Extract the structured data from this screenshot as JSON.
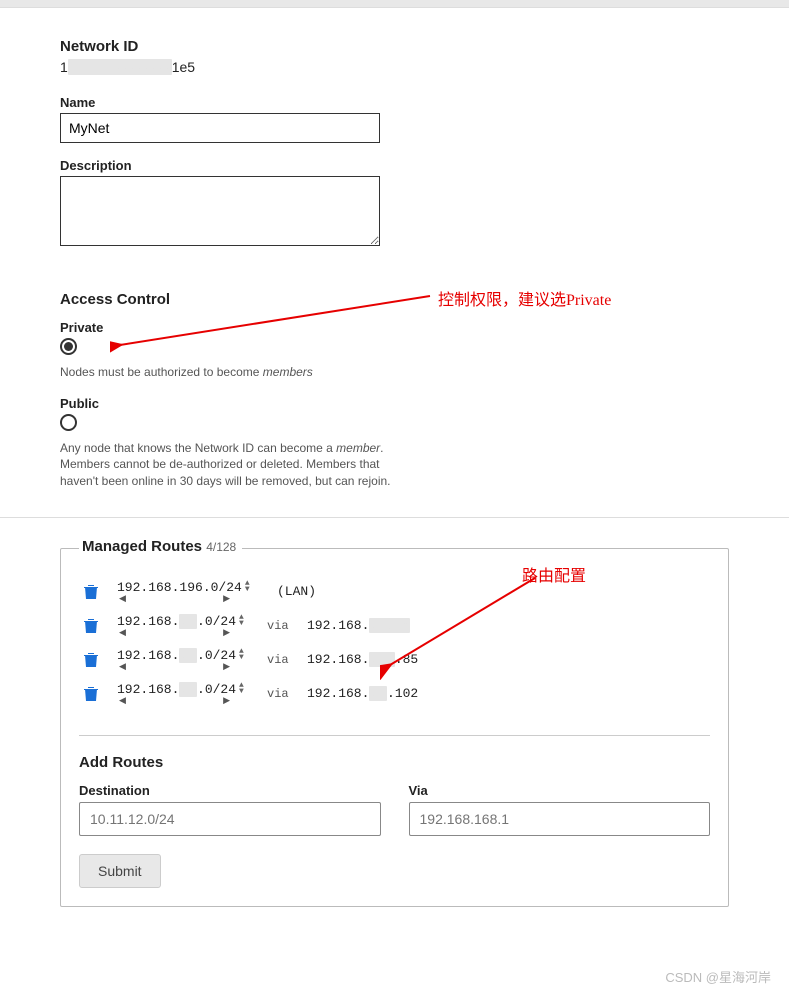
{
  "network_id": {
    "label": "Network ID",
    "value_prefix": "1",
    "value_suffix": "1e5"
  },
  "name": {
    "label": "Name",
    "value": "MyNet"
  },
  "description": {
    "label": "Description",
    "value": ""
  },
  "access_control": {
    "title": "Access Control",
    "private": {
      "label": "Private",
      "selected": true,
      "help_pre": "Nodes must be authorized to become ",
      "help_em": "members"
    },
    "public": {
      "label": "Public",
      "selected": false,
      "help_pre": "Any node that knows the Network ID can become a ",
      "help_em": "member",
      "help_post": ". Members cannot be de-authorized or deleted. Members that haven't been online in 30 days will be removed, but can rejoin."
    }
  },
  "routes": {
    "legend": "Managed Routes",
    "count": "4/128",
    "rows": [
      {
        "dest": "192.168.196.0/24",
        "via": "",
        "lan": "(LAN)"
      },
      {
        "dest_pre": "192.168.",
        "dest_post": ".0/24",
        "via_pre": "192.168.",
        "via_post": ""
      },
      {
        "dest_pre": "192.168.",
        "dest_post": ".0/24",
        "via_pre": "192.168.",
        "via_post": ".85"
      },
      {
        "dest_pre": "192.168.",
        "dest_post": ".0/24",
        "via_pre": "192.168.",
        "via_post": ".102"
      }
    ],
    "via_label": "via",
    "add": {
      "title": "Add Routes",
      "dest_label": "Destination",
      "dest_placeholder": "10.11.12.0/24",
      "via_label": "Via",
      "via_placeholder": "192.168.168.1",
      "submit": "Submit"
    }
  },
  "annotations": {
    "anno1": "控制权限，建议选Private",
    "anno2": "路由配置"
  },
  "watermark": "CSDN @星海河岸"
}
